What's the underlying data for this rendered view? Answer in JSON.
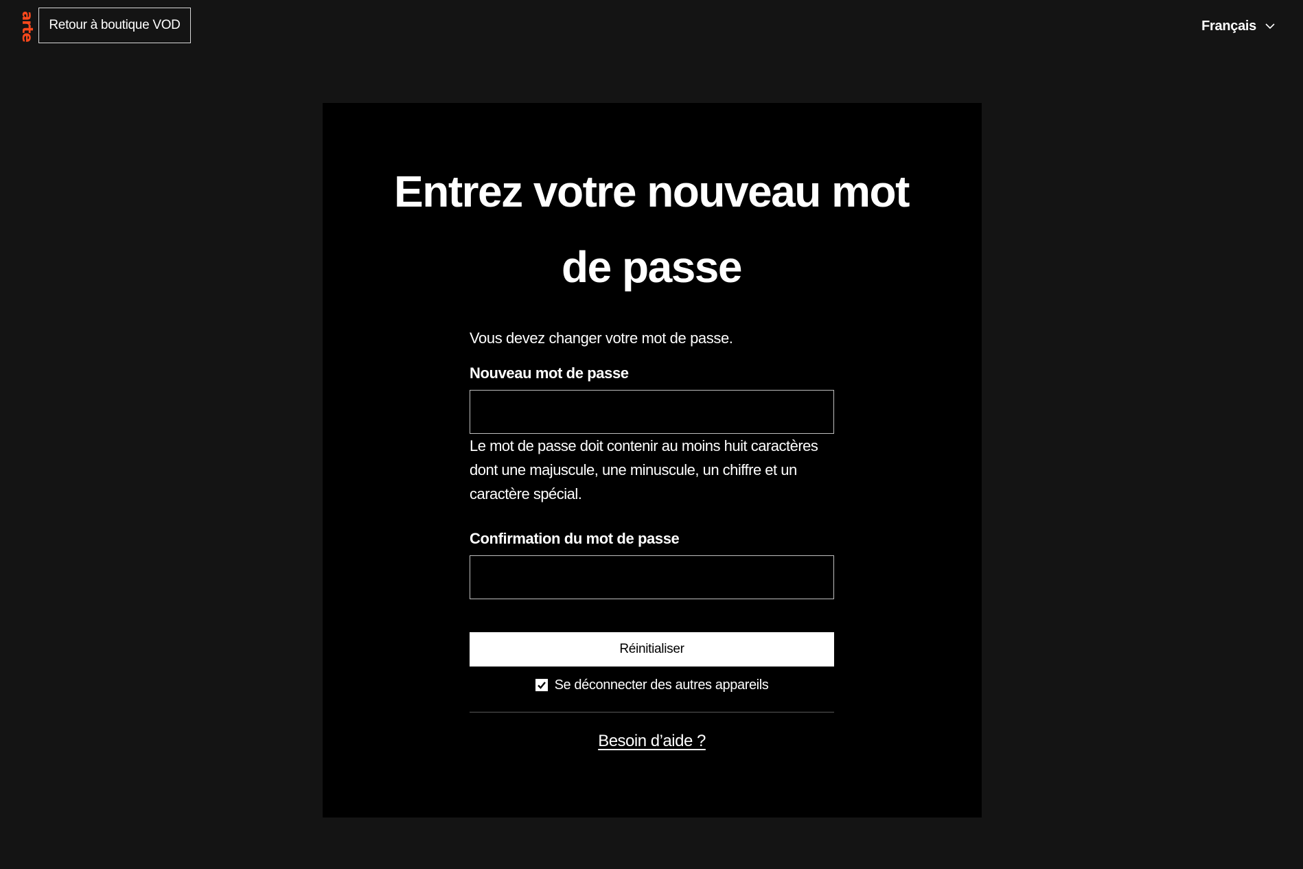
{
  "header": {
    "logo_text": "arte",
    "back_button_label": "Retour à boutique VOD",
    "language_label": "Français"
  },
  "form": {
    "title": "Entrez votre nouveau mot de passe",
    "intro": "Vous devez changer votre mot de passe.",
    "new_password": {
      "label": "Nouveau mot de passe",
      "value": "",
      "hint": "Le mot de passe doit contenir au moins huit caractères dont une majuscule, une minuscule, un chiffre et un caractère spécial."
    },
    "confirm_password": {
      "label": "Confirmation du mot de passe",
      "value": ""
    },
    "submit_label": "Réinitialiser",
    "logout_checkbox": {
      "label": "Se déconnecter des autres appareils",
      "checked": true
    },
    "help_link": "Besoin d’aide ?"
  },
  "colors": {
    "page_background": "#141414",
    "card_background": "#000000",
    "brand_orange": "#fa481c",
    "text": "#ffffff"
  },
  "icons": {
    "language_dropdown": "chevron-down-icon",
    "checkbox": "checkmark-icon"
  }
}
